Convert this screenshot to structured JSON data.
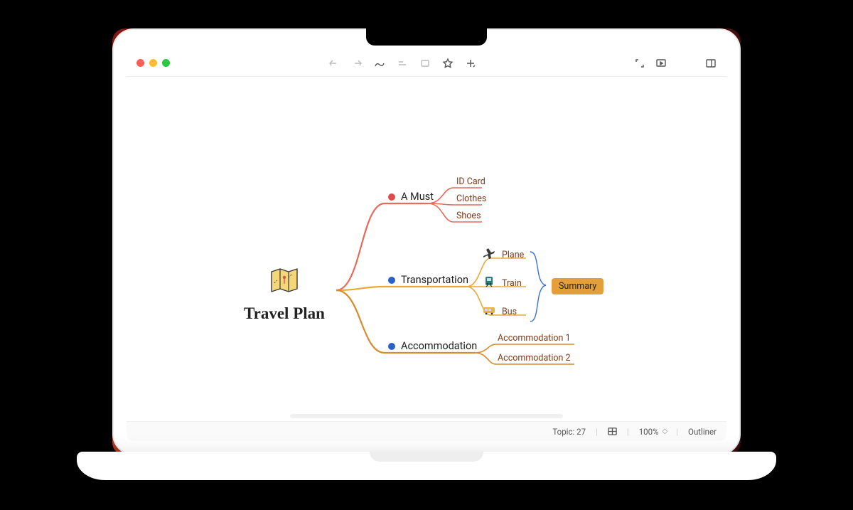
{
  "colors": {
    "must": "#e86a5b",
    "trans": "#e8a93a",
    "accom": "#d98a2b",
    "leaf_text": "#7a3b1a",
    "dot_must": "#e04b4b",
    "dot_trans": "#2b5fc9",
    "dot_accom": "#2b5fc9",
    "summary_bg": "#e59f3a"
  },
  "toolbar_icons": [
    "export",
    "share",
    "curve",
    "format",
    "frame",
    "star",
    "add"
  ],
  "toolbar_right_icons": [
    "fullscreen",
    "present",
    "split"
  ],
  "root": {
    "title": "Travel Plan"
  },
  "branches": {
    "must": {
      "label": "A Must",
      "leaves": [
        "ID Card",
        "Clothes",
        "Shoes"
      ]
    },
    "trans": {
      "label": "Transportation",
      "leaves": [
        {
          "icon": "plane-icon",
          "label": "Plane"
        },
        {
          "icon": "train-icon",
          "label": "Train"
        },
        {
          "icon": "bus-icon",
          "label": "Bus"
        }
      ],
      "summary": "Summary"
    },
    "accom": {
      "label": "Accommodation",
      "leaves": [
        "Accommodation 1",
        "Accommodation 2"
      ]
    }
  },
  "status": {
    "topic_label": "Topic:",
    "topic_count": "27",
    "zoom": "100%",
    "outliner": "Outliner"
  }
}
